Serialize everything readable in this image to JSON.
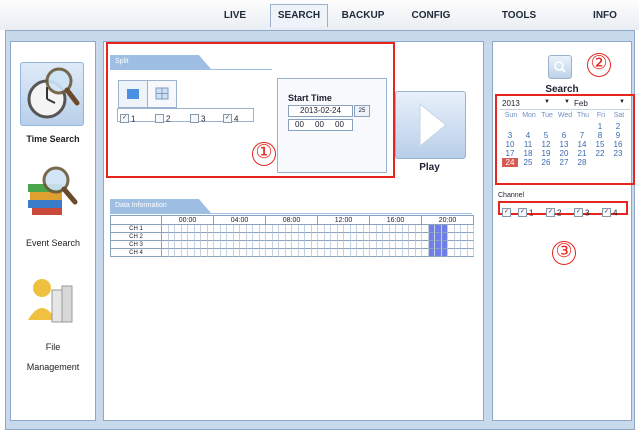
{
  "nav": {
    "tabs": [
      {
        "label": "LIVE"
      },
      {
        "label": "SEARCH"
      },
      {
        "label": "BACKUP"
      },
      {
        "label": "CONFIG"
      },
      {
        "label": "TOOLS"
      },
      {
        "label": "INFO"
      }
    ],
    "active": "SEARCH"
  },
  "sidebar": {
    "items": [
      {
        "label": "Time Search",
        "icon": "clock-magnifier-icon",
        "selected": true
      },
      {
        "label": "Event Search",
        "icon": "books-magnifier-icon",
        "selected": false
      },
      {
        "label": "File",
        "label2": "Management",
        "icon": "user-folder-icon",
        "selected": false
      }
    ]
  },
  "center": {
    "split_tab": "Split",
    "channels": [
      "1",
      "2",
      "3",
      "4"
    ],
    "channel_checked": [
      true,
      false,
      false,
      true
    ],
    "start_time": {
      "label": "Start Time",
      "date": "2013-02-24",
      "calendar_btn": "25",
      "hour": "00",
      "minute": "00",
      "second": "00"
    },
    "play_label": "Play",
    "data_tab": "Data Information",
    "hours": [
      "00:00",
      "04:00",
      "08:00",
      "12:00",
      "16:00",
      "20:00"
    ],
    "rows": [
      "CH 1",
      "CH 2",
      "CH 3",
      "CH 4"
    ],
    "recorded_cols": [
      41,
      42,
      43
    ]
  },
  "right": {
    "search_label": "Search",
    "year": "2013",
    "month": "Feb",
    "weekdays": [
      "Sun",
      "Mon",
      "Tue",
      "Wed",
      "Thu",
      "Fri",
      "Sat"
    ],
    "weeks": [
      [
        "",
        "",
        "",
        "",
        "",
        "1",
        "2"
      ],
      [
        "3",
        "4",
        "5",
        "6",
        "7",
        "8",
        "9"
      ],
      [
        "10",
        "11",
        "12",
        "13",
        "14",
        "15",
        "16"
      ],
      [
        "17",
        "18",
        "19",
        "20",
        "21",
        "22",
        "23"
      ],
      [
        "24",
        "25",
        "26",
        "27",
        "28",
        "",
        ""
      ]
    ],
    "selected_day": "24",
    "channel_title": "Channel",
    "channel_labels": [
      "1",
      "2",
      "3",
      "4"
    ]
  },
  "annotations": [
    "①",
    "②",
    "③"
  ],
  "colors": {
    "annotation_red": "#e5251e",
    "panel_blue": "#c9d9ec",
    "record_bar": "#6f7fe6",
    "selected_day": "#d65a4f"
  }
}
